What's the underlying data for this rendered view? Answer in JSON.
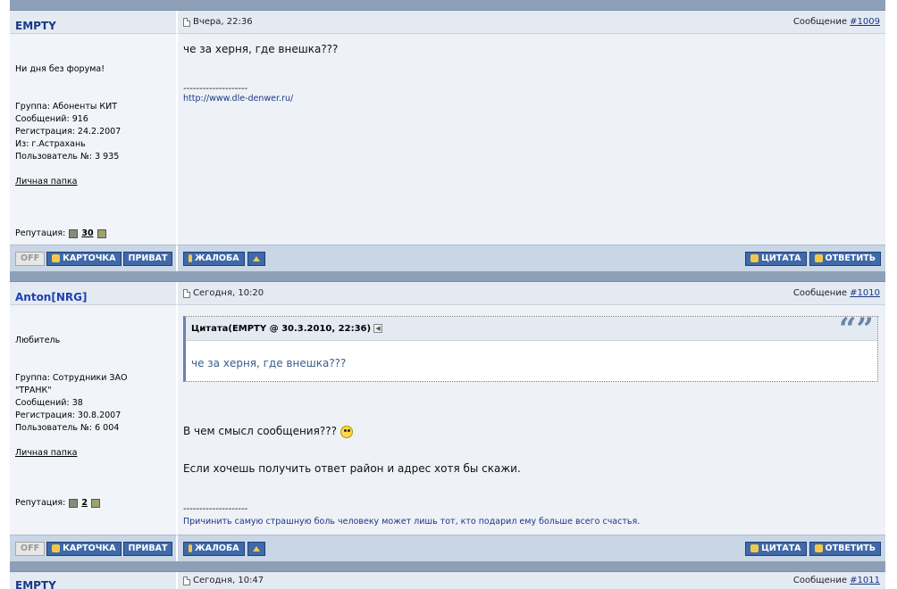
{
  "posts": [
    {
      "author": "EMPTY",
      "date": "Вчера, 22:36",
      "post_label": "Сообщение ",
      "post_number": "#1009",
      "status": "Ни дня без форума!",
      "group": "Группа: Абоненты КИТ",
      "messages": "Сообщений: 916",
      "registered": "Регистрация: 24.2.2007",
      "from": "Из: г.Астрахань",
      "user_no": "Пользователь №: 3 935",
      "folder": "Личная папка",
      "reputation_label": "Репутация:",
      "reputation_value": "30",
      "message": "че за херня, где внешка???",
      "sig_line": "--------------------",
      "signature": "http://www.dle-denwer.ru/"
    },
    {
      "author": "Anton[NRG]",
      "date": "Сегодня, 10:20",
      "post_label": "Сообщение ",
      "post_number": "#1010",
      "status": "Любитель",
      "group": "Группа: Сотрудники ЗАО \"ТРАНК\"",
      "messages": "Сообщений: 38",
      "registered": "Регистрация: 30.8.2007",
      "user_no": "Пользователь №: 6 004",
      "folder": "Личная папка",
      "reputation_label": "Репутация:",
      "reputation_value": "2",
      "quote_title": "Цитата(EMPTY @ 30.3.2010, 22:36)",
      "quote_text": "че за херня, где внешка???",
      "message1": "В чем смысл сообщения???",
      "message2": "Если хочешь получить ответ район и адрес хотя бы скажи.",
      "sig_line": "--------------------",
      "signature": "Причинить самую страшную боль человеку может лишь тот, кто подарил ему больше всего счастья."
    }
  ],
  "buttons": {
    "off": "OFF",
    "card": "КАРТОЧКА",
    "private": "ПРИВАТ",
    "complaint": "ЖАЛОБА",
    "quote": "ЦИТАТА",
    "reply": "ОТВЕТИТЬ"
  },
  "next_post": {
    "author": "EMPTY",
    "date": "Сегодня, 10:47",
    "post_label": "Сообщение ",
    "post_number": "#1011"
  },
  "colors": {
    "separator": "#8ea0b8",
    "button": "#3f69a8",
    "author": "#1a3787"
  }
}
